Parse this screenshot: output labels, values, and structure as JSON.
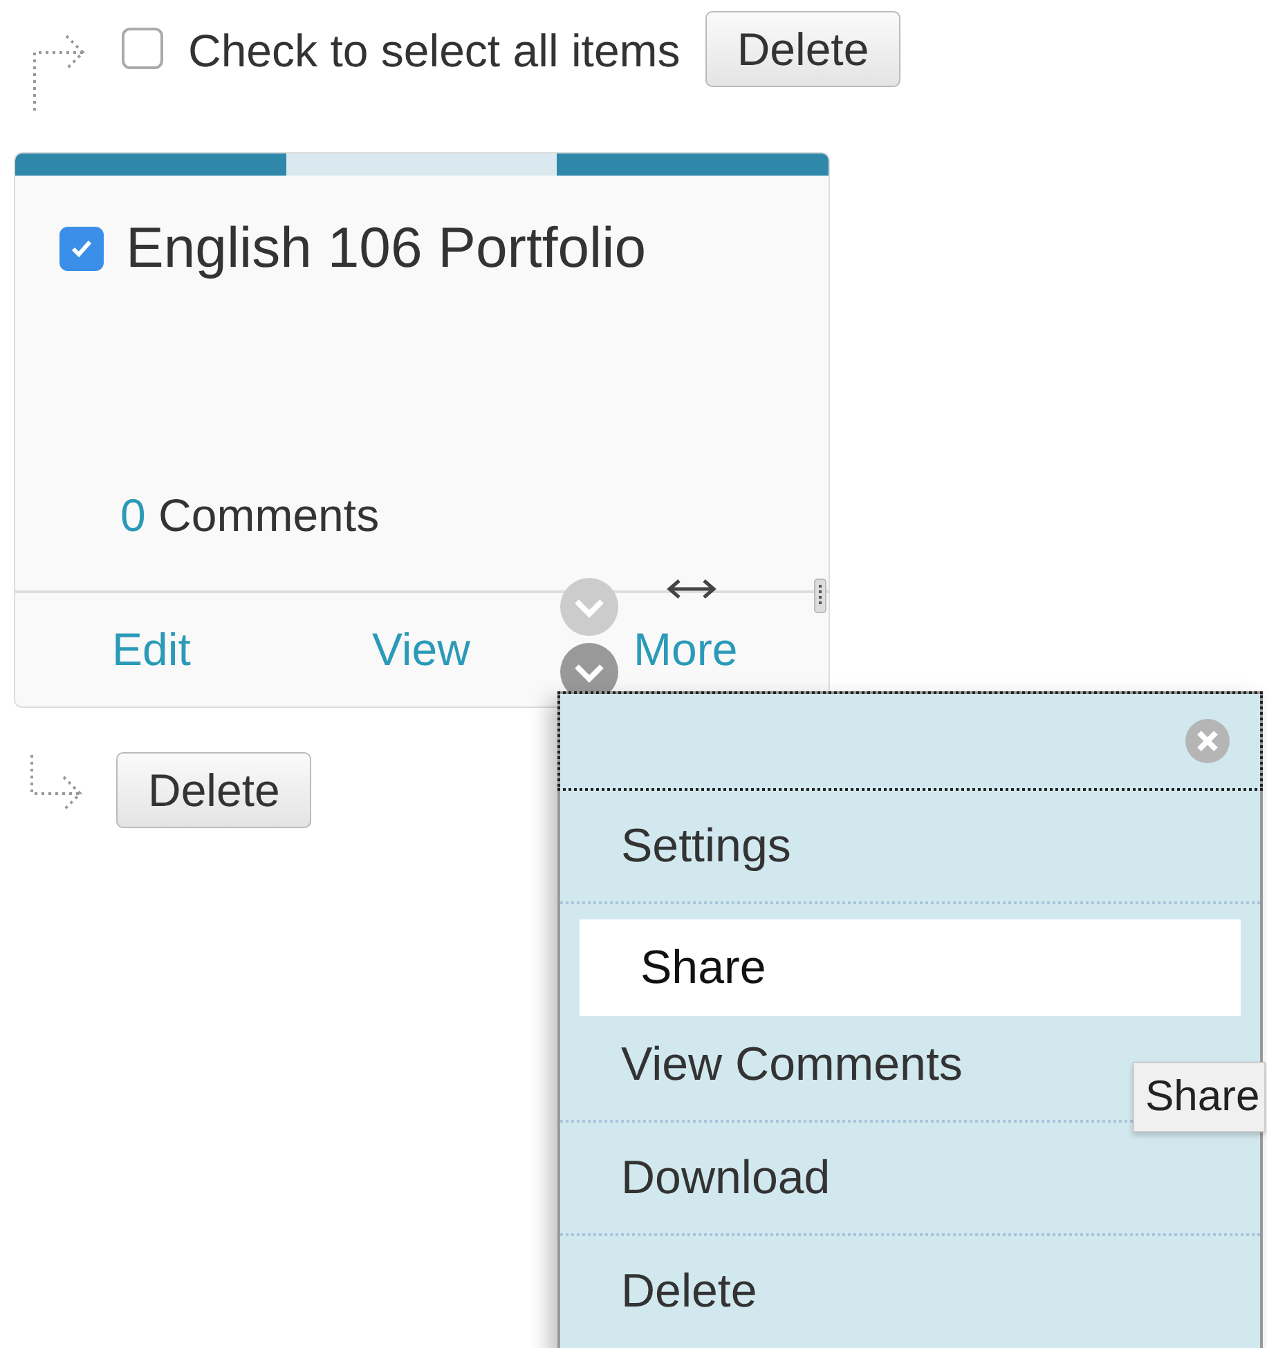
{
  "select_all": {
    "label": "Check to select all items",
    "checked": false
  },
  "top_button": "Delete",
  "card": {
    "checked": true,
    "title": "English 106 Portfolio",
    "comments_count": "0",
    "comments_label": "Comments",
    "actions": [
      {
        "label": "Edit",
        "kind": "link"
      },
      {
        "label": "View",
        "kind": "link"
      },
      {
        "label": "More",
        "kind": "menu"
      }
    ]
  },
  "bottom_button": "Delete",
  "menu": {
    "groups": [
      [
        {
          "label": "Settings",
          "selected": false
        }
      ],
      [
        {
          "label": "Share",
          "selected": true
        },
        {
          "label": "View Comments",
          "selected": false
        }
      ],
      [
        {
          "label": "Download",
          "selected": false
        }
      ],
      [
        {
          "label": "Delete",
          "selected": false
        }
      ]
    ]
  },
  "tooltip": "Share"
}
